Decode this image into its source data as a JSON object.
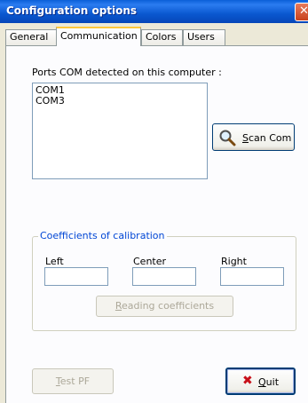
{
  "window": {
    "title": "Configuration options",
    "close_glyph": "✕"
  },
  "tabs": [
    {
      "label": "General",
      "active": false
    },
    {
      "label": "Communication",
      "active": true
    },
    {
      "label": "Colors",
      "active": false
    },
    {
      "label": "Users",
      "active": false
    }
  ],
  "communication": {
    "ports_label": "Ports COM detected on this computer :",
    "ports": [
      "COM1",
      "COM3"
    ],
    "scan_button": {
      "accel": "S",
      "rest": "can Com",
      "icon": "magnifier-icon"
    }
  },
  "calibration": {
    "group_title": "Coefficients of calibration",
    "fields": [
      {
        "label": "Left",
        "value": ""
      },
      {
        "label": "Center",
        "value": ""
      },
      {
        "label": "Right",
        "value": ""
      }
    ],
    "read_button": {
      "accel": "R",
      "rest": "eading coefficients",
      "enabled": false
    }
  },
  "footer": {
    "test_button": {
      "accel": "T",
      "rest": "est PF",
      "enabled": false
    },
    "quit_button": {
      "accel": "Q",
      "rest": "uit",
      "icon": "red-x-icon",
      "icon_color": "#c8101a"
    }
  },
  "colors": {
    "titlebar": "#0a58d0",
    "group_title": "#0046d5",
    "dialog_bg": "#ece9d8"
  }
}
